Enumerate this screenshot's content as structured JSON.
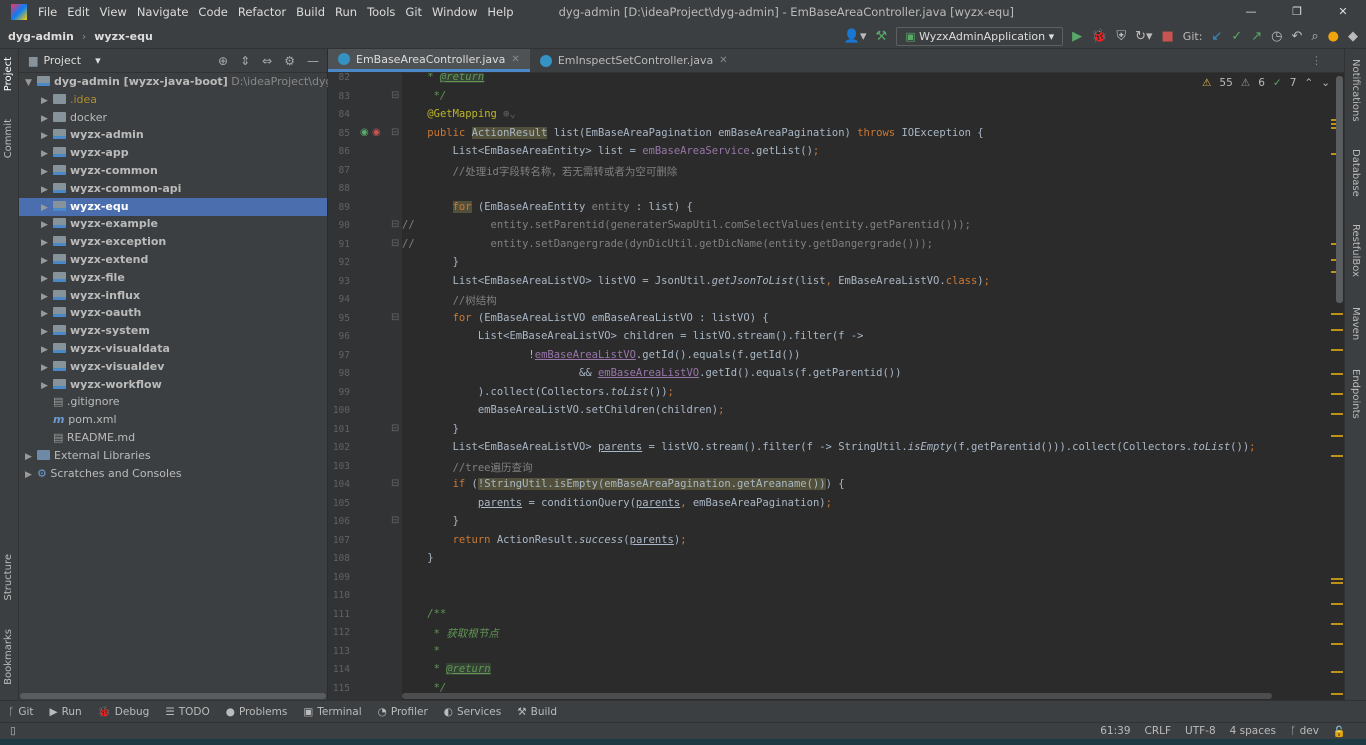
{
  "menu": [
    "File",
    "Edit",
    "View",
    "Navigate",
    "Code",
    "Refactor",
    "Build",
    "Run",
    "Tools",
    "Git",
    "Window",
    "Help"
  ],
  "window_title": "dyg-admin [D:\\ideaProject\\dyg-admin] - EmBaseAreaController.java [wyzx-equ]",
  "breadcrumb": [
    "dyg-admin",
    "wyzx-equ"
  ],
  "run_config": "WyzxAdminApplication",
  "git_label": "Git:",
  "project_panel": {
    "title": "Project",
    "tree": [
      {
        "label": "dyg-admin [wyzx-java-boot]",
        "extra": "D:\\ideaProject\\dyg-admin",
        "depth": 0,
        "open": true,
        "type": "mod"
      },
      {
        "label": ".idea",
        "depth": 1,
        "type": "folder",
        "style": "ex"
      },
      {
        "label": "docker",
        "depth": 1,
        "type": "folder"
      },
      {
        "label": "wyzx-admin",
        "depth": 1,
        "type": "mod"
      },
      {
        "label": "wyzx-app",
        "depth": 1,
        "type": "mod"
      },
      {
        "label": "wyzx-common",
        "depth": 1,
        "type": "mod"
      },
      {
        "label": "wyzx-common-api",
        "depth": 1,
        "type": "mod"
      },
      {
        "label": "wyzx-equ",
        "depth": 1,
        "type": "mod",
        "selected": true
      },
      {
        "label": "wyzx-example",
        "depth": 1,
        "type": "mod"
      },
      {
        "label": "wyzx-exception",
        "depth": 1,
        "type": "mod"
      },
      {
        "label": "wyzx-extend",
        "depth": 1,
        "type": "mod"
      },
      {
        "label": "wyzx-file",
        "depth": 1,
        "type": "mod"
      },
      {
        "label": "wyzx-influx",
        "depth": 1,
        "type": "mod"
      },
      {
        "label": "wyzx-oauth",
        "depth": 1,
        "type": "mod"
      },
      {
        "label": "wyzx-system",
        "depth": 1,
        "type": "mod"
      },
      {
        "label": "wyzx-visualdata",
        "depth": 1,
        "type": "mod"
      },
      {
        "label": "wyzx-visualdev",
        "depth": 1,
        "type": "mod"
      },
      {
        "label": "wyzx-workflow",
        "depth": 1,
        "type": "mod"
      },
      {
        "label": ".gitignore",
        "depth": 1,
        "type": "file"
      },
      {
        "label": "pom.xml",
        "depth": 1,
        "type": "maven"
      },
      {
        "label": "README.md",
        "depth": 1,
        "type": "file"
      },
      {
        "label": "External Libraries",
        "depth": 0,
        "type": "lib"
      },
      {
        "label": "Scratches and Consoles",
        "depth": 0,
        "type": "scratch"
      }
    ]
  },
  "left_tools": [
    "Project",
    "Commit",
    "Structure",
    "Bookmarks"
  ],
  "right_tools": [
    "Notifications",
    "Database",
    "RestfulBox",
    "Maven",
    "Endpoints"
  ],
  "tabs": [
    {
      "label": "EmBaseAreaController.java",
      "active": true
    },
    {
      "label": "EmInspectSetController.java"
    }
  ],
  "inspections": {
    "warnings": "55",
    "weak": "6",
    "ok": "7"
  },
  "code": [
    {
      "n": "82",
      "s": [
        [
          "    ",
          ""
        ],
        [
          "* ",
          "dc"
        ],
        [
          "@return",
          "tg"
        ]
      ]
    },
    {
      "n": "83",
      "s": [
        [
          "     */",
          "dc"
        ]
      ]
    },
    {
      "n": "84",
      "s": [
        [
          "    ",
          ""
        ],
        [
          "@GetMapping",
          "an"
        ],
        [
          " ⊕⌄",
          "ws"
        ]
      ]
    },
    {
      "n": "85",
      "s": [
        [
          "    ",
          ""
        ],
        [
          "public ",
          "kw"
        ],
        [
          "ActionResult",
          "hl"
        ],
        [
          " list(EmBaseAreaPagination emBaseAreaPagination) ",
          ""
        ],
        [
          "throws ",
          "kw"
        ],
        [
          "IOException {",
          ""
        ]
      ]
    },
    {
      "n": "86",
      "s": [
        [
          "        List<EmBaseAreaEntity> list = ",
          ""
        ],
        [
          "emBaseAreaService",
          "fd"
        ],
        [
          ".getList()",
          ""
        ],
        [
          ";",
          "kw"
        ]
      ]
    },
    {
      "n": "87",
      "s": [
        [
          "        //处理id字段转名称，若无需转或者为空可删除",
          "cm"
        ]
      ]
    },
    {
      "n": "88",
      "s": []
    },
    {
      "n": "89",
      "s": [
        [
          "        ",
          ""
        ],
        [
          "for",
          "kw hl"
        ],
        [
          " (EmBaseAreaEntity ",
          ""
        ],
        [
          "entity",
          "cm"
        ],
        [
          " : list) {",
          ""
        ]
      ]
    },
    {
      "n": "90",
      "s": [
        [
          "//            entity.setParentid(generaterSwapUtil.comSelectValues(entity.getParentid()));",
          "cm"
        ]
      ]
    },
    {
      "n": "91",
      "s": [
        [
          "//            entity.setDangergrade(dynDicUtil.getDicName(entity.getDangergrade()));",
          "cm"
        ]
      ]
    },
    {
      "n": "92",
      "s": [
        [
          "        }",
          ""
        ]
      ]
    },
    {
      "n": "93",
      "s": [
        [
          "        List<EmBaseAreaListVO> listVO = JsonUtil.",
          ""
        ],
        [
          "getJsonToList",
          "it"
        ],
        [
          "(list",
          ""
        ],
        [
          ", ",
          "kw"
        ],
        [
          "EmBaseAreaListVO.",
          ""
        ],
        [
          "class",
          "kw"
        ],
        [
          ")",
          ""
        ],
        [
          ";",
          "kw"
        ]
      ]
    },
    {
      "n": "94",
      "s": [
        [
          "        //树结构",
          "cm"
        ]
      ]
    },
    {
      "n": "95",
      "s": [
        [
          "        ",
          ""
        ],
        [
          "for ",
          "kw"
        ],
        [
          "(EmBaseAreaListVO emBaseAreaListVO : listVO) {",
          ""
        ]
      ]
    },
    {
      "n": "96",
      "s": [
        [
          "            List<EmBaseAreaListVO> children = listVO.stream().filter(f ->",
          ""
        ]
      ]
    },
    {
      "n": "97",
      "s": [
        [
          "                    !",
          ""
        ],
        [
          "emBaseAreaListVO",
          "fd ul"
        ],
        [
          ".getId().equals(f.getId())",
          ""
        ]
      ]
    },
    {
      "n": "98",
      "s": [
        [
          "                            && ",
          ""
        ],
        [
          "emBaseAreaListVO",
          "fd ul"
        ],
        [
          ".getId().equals(f.getParentid())",
          ""
        ]
      ]
    },
    {
      "n": "99",
      "s": [
        [
          "            ).collect(Collectors.",
          ""
        ],
        [
          "toList",
          "it"
        ],
        [
          "())",
          ""
        ],
        [
          ";",
          "kw"
        ]
      ]
    },
    {
      "n": "100",
      "s": [
        [
          "            emBaseAreaListVO.setChildren(children)",
          ""
        ],
        [
          ";",
          "kw"
        ]
      ]
    },
    {
      "n": "101",
      "s": [
        [
          "        }",
          ""
        ]
      ]
    },
    {
      "n": "102",
      "s": [
        [
          "        List<EmBaseAreaListVO> ",
          ""
        ],
        [
          "parents",
          "ul"
        ],
        [
          " = listVO.stream().filter(f -> StringUtil.",
          ""
        ],
        [
          "isEmpty",
          "it"
        ],
        [
          "(f.getParentid())).collect(Collectors.",
          ""
        ],
        [
          "toList",
          "it"
        ],
        [
          "())",
          ""
        ],
        [
          ";",
          "kw"
        ]
      ]
    },
    {
      "n": "103",
      "s": [
        [
          "        //tree遍历查询",
          "cm"
        ]
      ]
    },
    {
      "n": "104",
      "s": [
        [
          "        ",
          ""
        ],
        [
          "if ",
          "kw"
        ],
        [
          "(",
          ""
        ],
        [
          "!StringUtil.isEmpty(emBaseAreaPagination.getAreaname())",
          "hl"
        ],
        [
          ") {",
          ""
        ]
      ]
    },
    {
      "n": "105",
      "s": [
        [
          "            ",
          ""
        ],
        [
          "parents",
          "ul"
        ],
        [
          " = conditionQuery(",
          ""
        ],
        [
          "parents",
          "ul"
        ],
        [
          ", ",
          "kw"
        ],
        [
          "emBaseAreaPagination)",
          ""
        ],
        [
          ";",
          "kw"
        ]
      ]
    },
    {
      "n": "106",
      "s": [
        [
          "        }",
          ""
        ]
      ]
    },
    {
      "n": "107",
      "s": [
        [
          "        ",
          ""
        ],
        [
          "return ",
          "kw"
        ],
        [
          "ActionResult.",
          ""
        ],
        [
          "success",
          "it"
        ],
        [
          "(",
          ""
        ],
        [
          "parents",
          "ul"
        ],
        [
          ")",
          ""
        ],
        [
          ";",
          "kw"
        ]
      ]
    },
    {
      "n": "108",
      "s": [
        [
          "    }",
          ""
        ]
      ]
    },
    {
      "n": "109",
      "s": []
    },
    {
      "n": "110",
      "s": []
    },
    {
      "n": "111",
      "s": [
        [
          "    /**",
          "dc"
        ]
      ]
    },
    {
      "n": "112",
      "s": [
        [
          "     * 获取根节点",
          "dc"
        ]
      ]
    },
    {
      "n": "113",
      "s": [
        [
          "     *",
          "dc"
        ]
      ]
    },
    {
      "n": "114",
      "s": [
        [
          "     * ",
          "dc"
        ],
        [
          "@return",
          "tg"
        ]
      ]
    },
    {
      "n": "115",
      "s": [
        [
          "     */",
          "dc"
        ]
      ]
    }
  ],
  "bottom_tools": [
    "Git",
    "Run",
    "Debug",
    "TODO",
    "Problems",
    "Terminal",
    "Profiler",
    "Services",
    "Build"
  ],
  "status": {
    "position": "61:39",
    "line_sep": "CRLF",
    "encoding": "UTF-8",
    "indent": "4 spaces",
    "branch": "dev"
  },
  "colors": {
    "accent": "#4b6eaf",
    "keyword": "#cc7832",
    "comment": "#808080",
    "annotation": "#bbb529",
    "field": "#9876aa"
  }
}
